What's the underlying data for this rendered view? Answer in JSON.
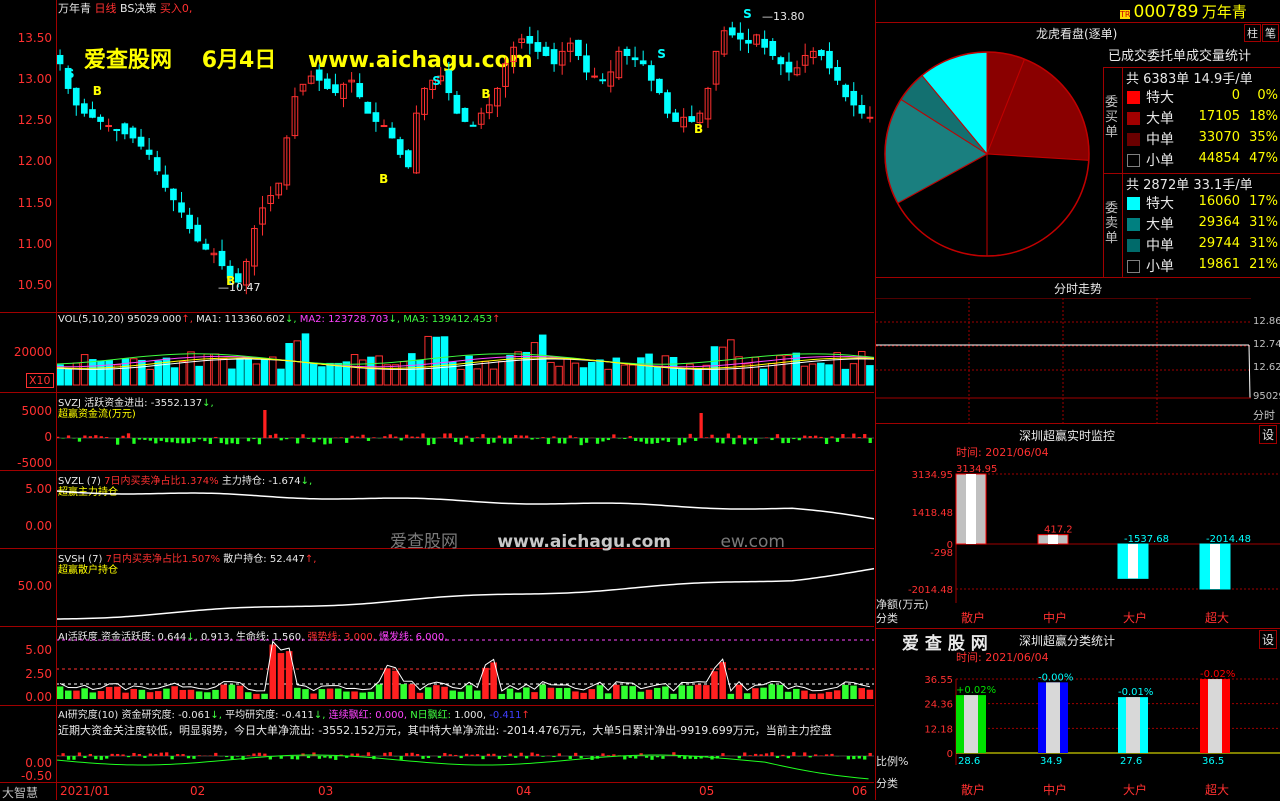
{
  "top_header": {
    "stock_name": "万年青",
    "period": "日线",
    "strategy": "BS决策",
    "buy_label": "买入",
    "buy_value": "0,"
  },
  "watermark": {
    "site": "爱查股网",
    "date": "6月4日",
    "url": "www.aichagu.com",
    "mid_site": "爱查股网",
    "mid_url": "www.aichagu.com",
    "mid_tail": "ew.com"
  },
  "price_axis": [
    "13.50",
    "13.00",
    "12.50",
    "12.00",
    "11.50",
    "11.00",
    "10.50"
  ],
  "annotations": {
    "high": "13.80",
    "low": "10.47"
  },
  "signals": {
    "s": "S",
    "b": "B"
  },
  "vol": {
    "title": "VOL(5,10,20)",
    "value": "95029.000",
    "ma1_label": "MA1:",
    "ma1": "113360.602",
    "ma2_label": "MA2:",
    "ma2": "123728.703",
    "ma3_label": "MA3:",
    "ma3": "139412.453",
    "axis": "20000",
    "unit": "X10"
  },
  "svzj": {
    "title": "SVZJ",
    "label": "活跃资金进出:",
    "value": "-3552.137",
    "subtitle": "超赢资金流(万元)",
    "axis": [
      "5000",
      "0",
      "-5000"
    ]
  },
  "svzl": {
    "title": "SVZL (7)",
    "label1": "7日内买卖净占比1.374%",
    "label2": "主力持仓:",
    "value": "-1.674",
    "subtitle": "超赢主力持仓",
    "axis": [
      "5.00",
      "0.00"
    ]
  },
  "svsh": {
    "title": "SVSH (7)",
    "label1": "7日内买卖净占比1.507%",
    "label2": "散户持仓:",
    "value": "52.447",
    "subtitle": "超赢散户持仓",
    "axis": [
      "50.00"
    ]
  },
  "ai_active": {
    "title": "AI活跃度",
    "label": "资金活跃度:",
    "v1": "0.644",
    "v2": "0.913,",
    "life_label": "生命线:",
    "life": "1.560,",
    "strong": "强势线: 3.000,",
    "burst": "爆发线: 6.000,",
    "axis": [
      "5.00",
      "2.50",
      "0.00"
    ]
  },
  "ai_research": {
    "title": "AI研究度(10)",
    "label": "资金研究度:",
    "v1": "-0.061",
    "avg_label": "平均研究度:",
    "avg": "-0.411",
    "red_label": "连续飘红:",
    "red": "0.000,",
    "n_label": "N日飘红:",
    "n": "1.000,",
    "n2": "-0.411",
    "comment": "近期大资金关注度较低，明显弱势，今日大单净流出: -3552.152万元，其中特大单净流出: -2014.476万元，大单5日累计净出-9919.699万元，当前主力控盘",
    "axis": [
      "0.00",
      "-0.50"
    ]
  },
  "xaxis": {
    "left": "大智慧",
    "dates": [
      "2021/01",
      "02",
      "03",
      "04",
      "05",
      "06"
    ]
  },
  "right_header": {
    "tr": "TR",
    "code": "000789",
    "name": "万年青"
  },
  "dragon": {
    "title": "龙虎看盘(逐单)",
    "btn1": "柱",
    "btn2": "笔",
    "subtitle": "已成交委托单成交量统计",
    "buy_label": "委买单",
    "buy_total": "共 6383单 14.9手/单",
    "buy_rows": [
      {
        "name": "特大",
        "vol": "0",
        "pct": "0%",
        "color": "#ff0000"
      },
      {
        "name": "大单",
        "vol": "17105",
        "pct": "18%",
        "color": "#a00000"
      },
      {
        "name": "中单",
        "vol": "33070",
        "pct": "35%",
        "color": "#6a0000"
      },
      {
        "name": "小单",
        "vol": "44854",
        "pct": "47%",
        "color": "#000000"
      }
    ],
    "sell_label": "委卖单",
    "sell_total": "共 2872单 33.1手/单",
    "sell_rows": [
      {
        "name": "特大",
        "vol": "16060",
        "pct": "17%",
        "color": "#00ffff"
      },
      {
        "name": "大单",
        "vol": "29364",
        "pct": "31%",
        "color": "#008080"
      },
      {
        "name": "中单",
        "vol": "29744",
        "pct": "31%",
        "color": "#006a6a"
      },
      {
        "name": "小单",
        "vol": "19861",
        "pct": "21%",
        "color": "#000000"
      }
    ]
  },
  "intraday": {
    "title": "分时走势",
    "axis": [
      "12.86",
      "12.74",
      "12.62"
    ],
    "vol": "95029",
    "time": "分时"
  },
  "monitor": {
    "title": "深圳超赢实时监控",
    "set": "设",
    "date": "时间: 2021/06/04",
    "axis": [
      "3134.95",
      "1418.48",
      "0",
      "-298",
      "-2014.48"
    ],
    "ylabel1": "净额(万元)",
    "ylabel2": "分类",
    "bars": [
      {
        "cat": "散户",
        "value": "3134.95"
      },
      {
        "cat": "中户",
        "value": "417.2"
      },
      {
        "cat": "大户",
        "value": "-1537.68"
      },
      {
        "cat": "超大",
        "value": "-2014.48"
      }
    ]
  },
  "classify": {
    "site": "爱 查 股 网",
    "title": "深圳超赢分类统计",
    "set": "设",
    "date": "时间: 2021/06/04",
    "axis": [
      "36.55",
      "24.36",
      "12.18",
      "0"
    ],
    "ylabel1": "比例%",
    "ylabel2": "分类",
    "bars": [
      {
        "cat": "散户",
        "value": "28.6",
        "change": "+0.02%",
        "color": "#00e000"
      },
      {
        "cat": "中户",
        "value": "34.9",
        "change": "-0.00%",
        "color": "#0000ff"
      },
      {
        "cat": "大户",
        "value": "27.6",
        "change": "-0.01%",
        "color": "#00ffff"
      },
      {
        "cat": "超大",
        "value": "36.5",
        "change": "-0.02%",
        "color": "#ff0000"
      }
    ]
  },
  "colors": {
    "up": "#ff3030",
    "down": "#00ffff",
    "grid": "#a00000"
  }
}
